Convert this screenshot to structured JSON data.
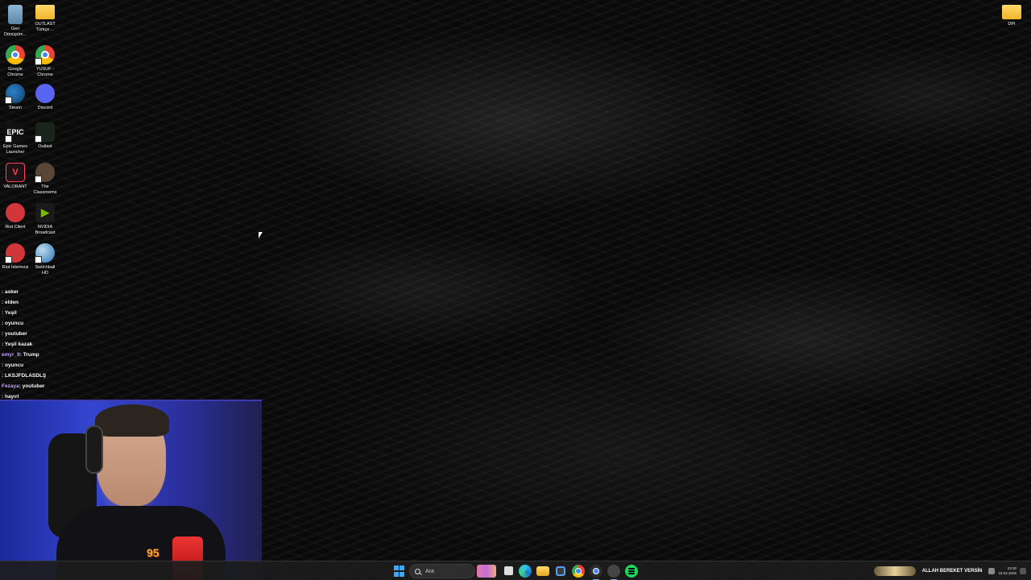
{
  "desktop": {
    "icons_left": [
      {
        "label": "Geri\nDönüşüm...",
        "icon": "recycle-bin-icon"
      },
      {
        "label": "OUTLAST\nTürkçe ...",
        "icon": "folder-icon"
      },
      {
        "label": "Google\nChrome",
        "icon": "chrome-icon"
      },
      {
        "label": "YUSUF -\nChrome",
        "icon": "chrome-icon"
      },
      {
        "label": "Steam",
        "icon": "steam-icon"
      },
      {
        "label": "Discord",
        "icon": "discord-icon"
      },
      {
        "label": "Epic Games\nLauncher",
        "icon": "epic-games-icon",
        "glyph": "EPIC"
      },
      {
        "label": "Outlast",
        "icon": "outlast-icon"
      },
      {
        "label": "VALORANT",
        "icon": "valorant-icon",
        "glyph": "V"
      },
      {
        "label": "The\nClassrooms",
        "icon": "classrooms-icon"
      },
      {
        "label": "Riot Client",
        "icon": "riot-client-icon"
      },
      {
        "label": "NVIDIA\nBroadcast",
        "icon": "nvidia-icon"
      },
      {
        "label": "Riot İstemcisi",
        "icon": "riot-client-icon"
      },
      {
        "label": "Switchball\nHD",
        "icon": "switchball-icon"
      }
    ],
    "icon_right": {
      "label": "DPI",
      "icon": "folder-icon"
    }
  },
  "chat": [
    {
      "user": "",
      "msg": ": asker"
    },
    {
      "user": "",
      "msg": ": elden"
    },
    {
      "user": "",
      "msg": ": Yeşil"
    },
    {
      "user": "",
      "msg": ": oyuncu"
    },
    {
      "user": "",
      "msg": ": youtuber"
    },
    {
      "user": "",
      "msg": ": Yeşil kazak"
    },
    {
      "user": "emyr_9",
      "msg": ": Trump"
    },
    {
      "user": "",
      "msg": ": oyuncu"
    },
    {
      "user": "",
      "msg": ": LKSJFDLASDLŞ"
    },
    {
      "user": "Fezaya",
      "msg": ": youtuber"
    },
    {
      "user": "",
      "msg": ": hayırl"
    }
  ],
  "taskbar": {
    "search_placeholder": "Ara",
    "apps": [
      "task-view-icon",
      "edge-icon",
      "file-explorer-icon",
      "store-icon",
      "chrome-icon",
      "chrome-icon",
      "app-icon",
      "spotify-icon"
    ],
    "marquee_text": "ALLAH BEREKET VERSİN",
    "clock_time": "23:30",
    "clock_date": "18.04.2026"
  },
  "colors": {
    "accent": "#3fa9f5",
    "spotify": "#1ed760",
    "chat_user": "#c9a9ff",
    "webcam_bg": "#2a3ac0"
  }
}
